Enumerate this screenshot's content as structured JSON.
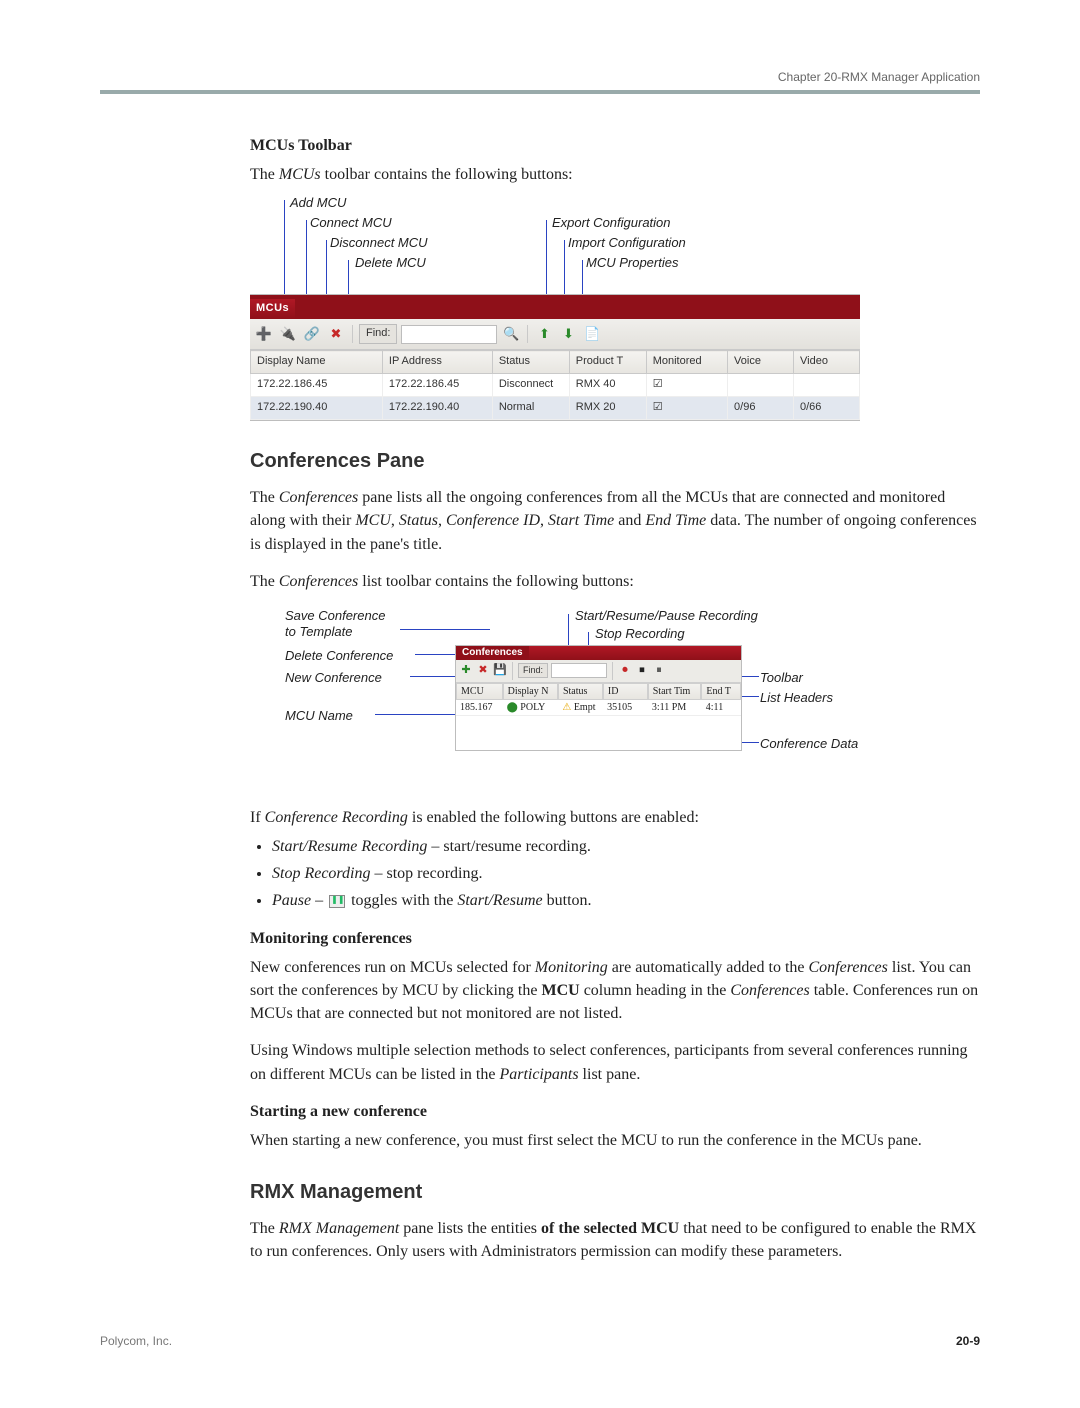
{
  "header": {
    "chapter": "Chapter 20-RMX Manager Application"
  },
  "s1": {
    "title": "MCUs Toolbar",
    "intro_a": "The ",
    "intro_em": "MCUs",
    "intro_b": " toolbar contains the following buttons:"
  },
  "fig1": {
    "callouts": {
      "add": "Add MCU",
      "connect": "Connect MCU",
      "disconnect": "Disconnect MCU",
      "delete": "Delete MCU",
      "export": "Export Configuration",
      "import": "Import Configuration",
      "props": "MCU Properties"
    },
    "panel_title": "MCUs",
    "find_label": "Find:",
    "columns": [
      "Display Name",
      "IP Address",
      "Status",
      "Product T",
      "Monitored",
      "Voice",
      "Video"
    ],
    "rows": [
      {
        "name": "172.22.186.45",
        "ip": "172.22.186.45",
        "status": "Disconnect",
        "prod": "RMX 40",
        "mon": "☑",
        "voice": "",
        "video": ""
      },
      {
        "name": "172.22.190.40",
        "ip": "172.22.190.40",
        "status": "Normal",
        "prod": "RMX 20",
        "mon": "☑",
        "voice": "0/96",
        "video": "0/66"
      }
    ]
  },
  "s2": {
    "title": "Conferences Pane",
    "p1_a": "The ",
    "p1_em": "Conferences",
    "p1_b": " pane lists all the ongoing conferences from all the MCUs that are connected and monitored along with their ",
    "p1_em2": "MCU",
    "p1_c": ", ",
    "p1_em3": "Status",
    "p1_d": ", ",
    "p1_em4": "Conference ID",
    "p1_e": ", ",
    "p1_em5": "Start Time",
    "p1_f": " and ",
    "p1_em6": "End Time",
    "p1_g": " data. The number of ongoing conferences is displayed in the pane's title.",
    "p2_a": "The ",
    "p2_em": "Conferences",
    "p2_b": " list toolbar contains the following buttons:"
  },
  "fig2": {
    "left": {
      "save": "Save Conference",
      "template": "to Template",
      "delete": "Delete Conference",
      "new": "New Conference",
      "mcu": "MCU Name"
    },
    "right": {
      "start": "Start/Resume/Pause Recording",
      "stop": "Stop Recording",
      "toolbar": "Toolbar",
      "headers": "List Headers",
      "data": "Conference Data"
    },
    "panel_title": "Conferences",
    "columns": [
      "MCU",
      "Display N",
      "Status",
      "ID",
      "Start Tim",
      "End T"
    ],
    "row": {
      "mcu": "185.167",
      "name": "POLY",
      "status": "Empt",
      "id": "35105",
      "start": "3:11 PM",
      "end": "4:11"
    }
  },
  "s3": {
    "p3_a": "If ",
    "p3_em": "Conference Recording",
    "p3_b": " is enabled the following buttons are enabled:",
    "b1_em": "Start/Resume Recording",
    "b1_t": " – start/resume recording.",
    "b2_em": "Stop Recording",
    "b2_t": " – stop recording.",
    "b3_em": "Pause",
    "b3_t": " – ",
    "b3_t2": " toggles with the ",
    "b3_em2": "Start/Resume",
    "b3_t3": " button."
  },
  "s4": {
    "title": "Monitoring conferences",
    "p_a": "New conferences run on MCUs selected for ",
    "p_em": "Monitoring",
    "p_b": " are automatically added to the ",
    "p_em2": "Conferences",
    "p_c": " list. You can sort the conferences by MCU by clicking the ",
    "p_bold": "MCU",
    "p_d": " column heading in the ",
    "p_em3": "Conferences",
    "p_e": " table. Conferences run on MCUs that are connected but not monitored are not listed.",
    "p2_a": "Using Windows multiple selection methods to select conferences, participants from several conferences running on different MCUs can be listed in the ",
    "p2_em": "Participants",
    "p2_b": " list pane."
  },
  "s5": {
    "title": "Starting a new conference",
    "p": "When starting a new conference, you must first select the MCU to run the conference in the MCUs pane."
  },
  "s6": {
    "title": "RMX Management",
    "p_a": "The ",
    "p_em": "RMX Management",
    "p_b": " pane lists the entities ",
    "p_bold": "of the selected MCU",
    "p_c": " that need to be configured to enable the RMX to run conferences. Only users with Administrators permission can modify these parameters."
  },
  "footer": {
    "company": "Polycom, Inc.",
    "page": "20-9"
  }
}
